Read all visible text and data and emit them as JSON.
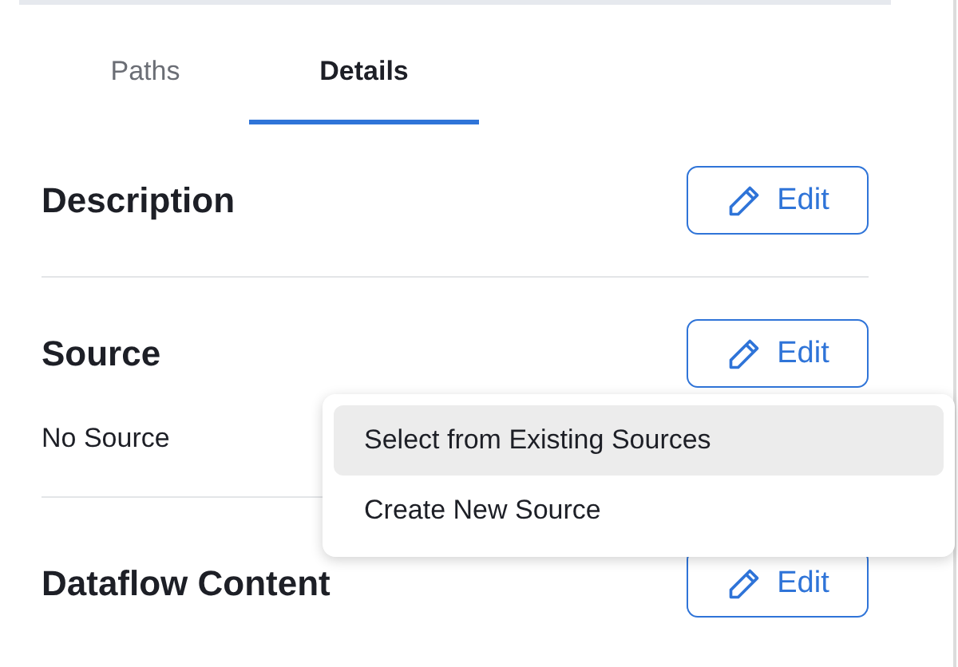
{
  "tabs": [
    {
      "label": "Paths",
      "selected": false
    },
    {
      "label": "Details",
      "selected": true
    }
  ],
  "sections": [
    {
      "title": "Description",
      "button": "Edit"
    },
    {
      "title": "Source",
      "button": "Edit",
      "value": "No Source"
    },
    {
      "title": "Dataflow Content",
      "button": "Edit"
    }
  ],
  "menu": {
    "items": [
      {
        "label": "Select from Existing Sources",
        "selected": true
      },
      {
        "label": "Create New Source",
        "selected": false
      }
    ]
  }
}
